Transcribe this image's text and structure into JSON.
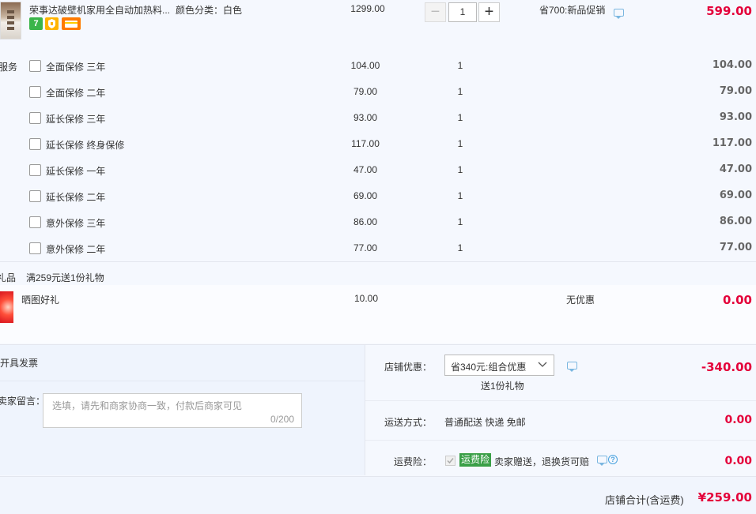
{
  "product": {
    "title": "荣事达破壁机家用全自动加热料...",
    "sku": "颜色分类：白色",
    "badges": [
      "7",
      "shield",
      "card"
    ],
    "price": "1299.00",
    "quantity": "1",
    "minus": "−",
    "plus": "+",
    "promo": "省700:新品促销",
    "total": "599.00"
  },
  "services": {
    "label": "服务",
    "items": [
      {
        "name": "全面保修 三年",
        "price": "104.00",
        "qty": "1",
        "total": "104.00"
      },
      {
        "name": "全面保修 二年",
        "price": "79.00",
        "qty": "1",
        "total": "79.00"
      },
      {
        "name": "延长保修 三年",
        "price": "93.00",
        "qty": "1",
        "total": "93.00"
      },
      {
        "name": "延长保修 终身保修",
        "price": "117.00",
        "qty": "1",
        "total": "117.00"
      },
      {
        "name": "延长保修 一年",
        "price": "47.00",
        "qty": "1",
        "total": "47.00"
      },
      {
        "name": "延长保修 二年",
        "price": "69.00",
        "qty": "1",
        "total": "69.00"
      },
      {
        "name": "意外保修 三年",
        "price": "86.00",
        "qty": "1",
        "total": "86.00"
      },
      {
        "name": "意外保修 二年",
        "price": "77.00",
        "qty": "1",
        "total": "77.00"
      }
    ]
  },
  "gift": {
    "label": "礼品",
    "rule": "满259元送1份礼物",
    "name": "晒图好礼",
    "price": "10.00",
    "discount": "无优惠",
    "total": "0.00"
  },
  "invoice": {
    "label": "开具发票"
  },
  "message": {
    "label": "卖家留言：",
    "placeholder": "选填，请先和商家协商一致，付款后商家可见",
    "counter": "0/200"
  },
  "store_discount": {
    "label": "店铺优惠：",
    "selected": "省340元:组合优惠",
    "note": "送1份礼物",
    "amount": "-340.00"
  },
  "shipping": {
    "label": "运送方式：",
    "value": "普通配送 快递 免邮",
    "amount": "0.00"
  },
  "insurance": {
    "label": "运费险：",
    "tag": "运费险",
    "desc": "卖家赠送，退换货可赔",
    "amount": "0.00"
  },
  "summary": {
    "label": "店铺合计(含运费)",
    "total": "¥259.00"
  },
  "colors": {
    "accent_red": "#e4003a",
    "insurance_green": "#3a9f47",
    "link_blue": "#7ab6e0"
  }
}
